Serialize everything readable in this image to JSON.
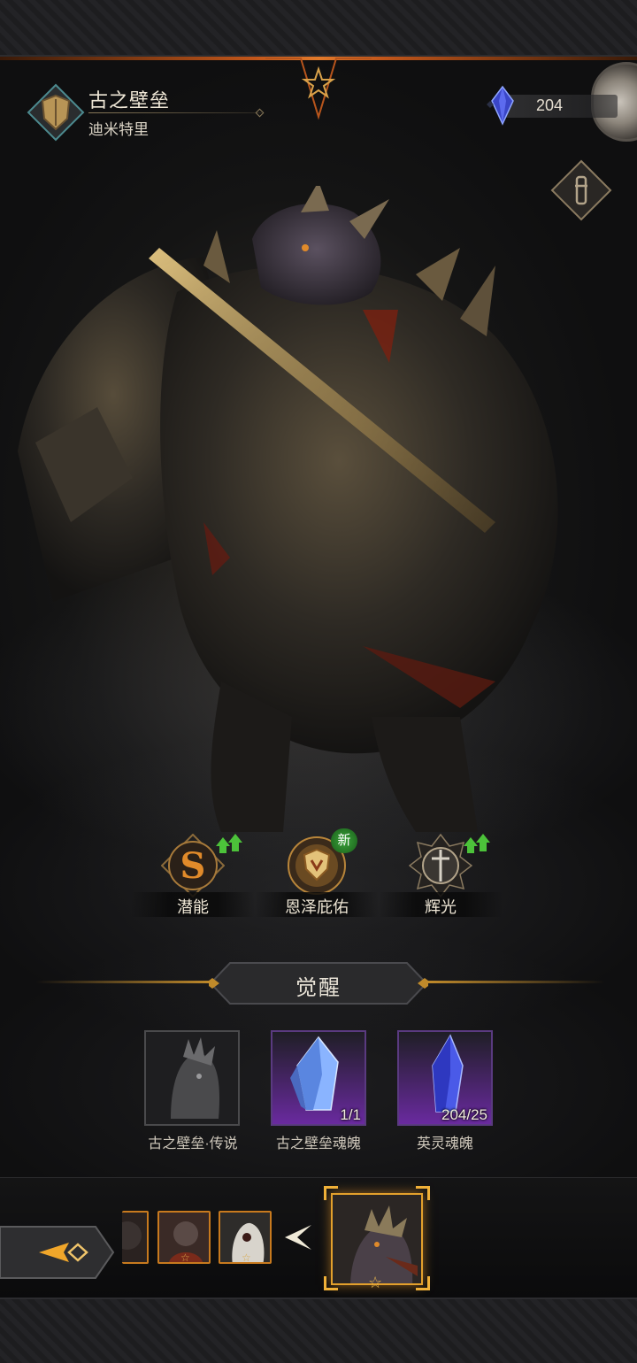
{
  "hero": {
    "name": "古之壁垒",
    "subtitle": "迪米特里"
  },
  "currency": {
    "icon": "blue-crystal-icon",
    "value": "204"
  },
  "skills": [
    {
      "label": "潜能",
      "icon": "potential-s-icon",
      "indicator": "upgrade-arrow"
    },
    {
      "label": "恩泽庇佑",
      "icon": "shield-blessing-icon",
      "indicator": "新"
    },
    {
      "label": "辉光",
      "icon": "radiance-sword-icon",
      "indicator": "upgrade-arrow"
    }
  ],
  "awaken": {
    "title": "觉醒",
    "items": [
      {
        "label": "古之壁垒·传说",
        "count": "",
        "icon": "hero-portrait-gray"
      },
      {
        "label": "古之壁垒魂魄",
        "count": "1/1",
        "icon": "soul-crystal-icon"
      },
      {
        "label": "英灵魂魄",
        "count": "204/25",
        "icon": "heroic-crystal-icon"
      }
    ]
  },
  "colors": {
    "accent_orange": "#e27a2b",
    "gold": "#c08a2a",
    "epic_purple": "#6a2aa0",
    "upgrade_green": "#4cc23a"
  }
}
